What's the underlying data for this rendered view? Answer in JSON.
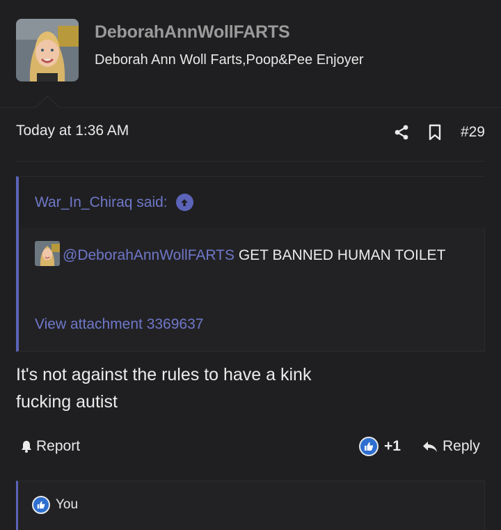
{
  "post": {
    "author": {
      "username": "DeborahAnnWollFARTS",
      "title": "Deborah Ann Woll Farts,Poop&Pee Enjoyer"
    },
    "timestamp": "Today at 1:36 AM",
    "post_number": "#29",
    "quote": {
      "author_label": "War_In_Chiraq said:",
      "mention": "@DeborahAnnWollFARTS",
      "text": " GET BANNED HUMAN TOILET",
      "attachment_link": "View attachment 3369637"
    },
    "message_lines": [
      "It's not against the rules to have a kink",
      "fucking autist"
    ],
    "actions": {
      "report_label": "Report",
      "reaction_count": "+1",
      "reply_label": "Reply"
    },
    "reactions_bar": {
      "label": "You"
    }
  },
  "colors": {
    "background": "#1f1f21",
    "accent": "#5b64b8",
    "link": "#6f78c9",
    "like": "#2e6fd0"
  },
  "icons": {
    "share": "share-icon",
    "bookmark": "bookmark-icon",
    "quote_jump": "arrow-up-circle-icon",
    "report": "bell-icon",
    "like": "thumbs-up-icon",
    "reply": "reply-icon"
  }
}
